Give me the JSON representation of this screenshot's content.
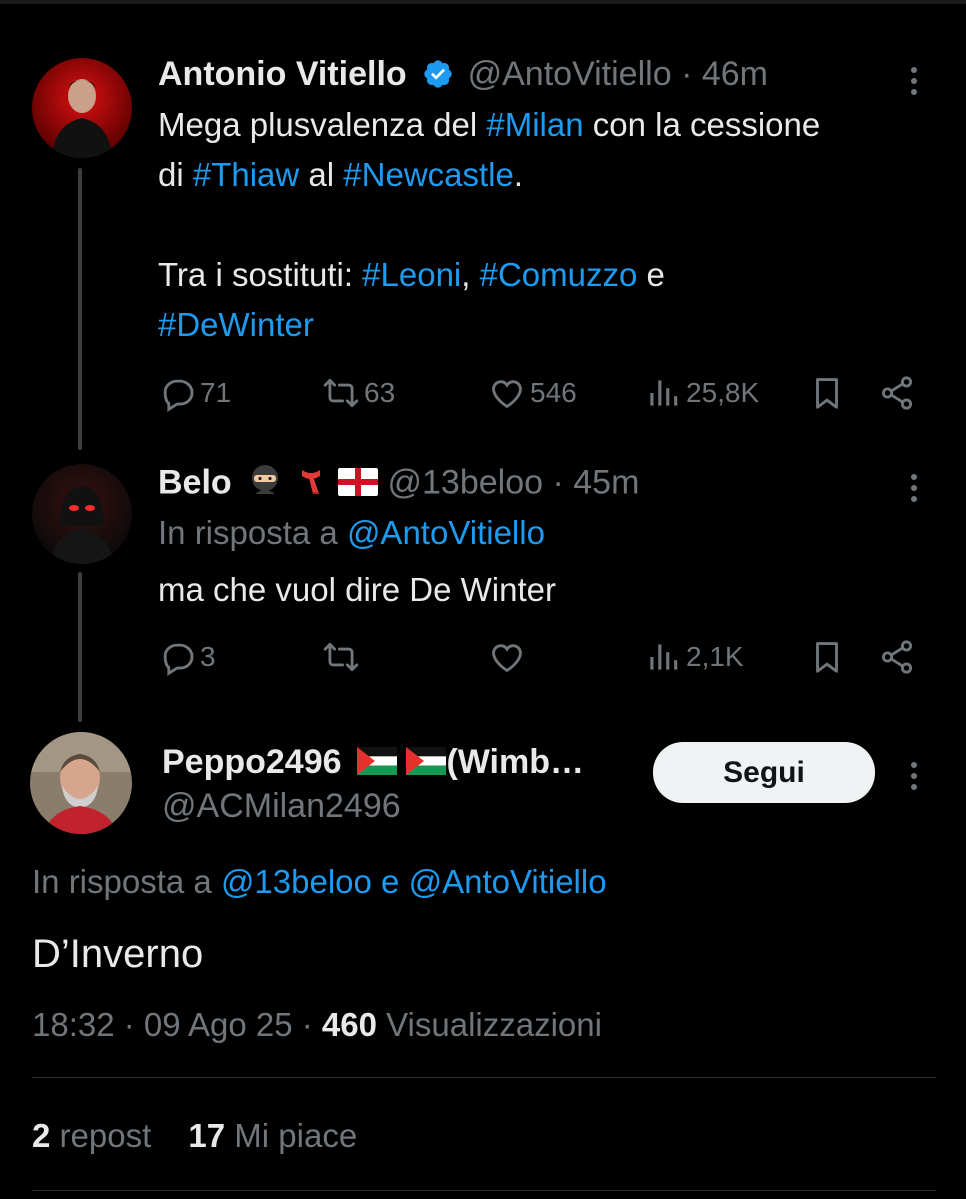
{
  "tweet1": {
    "name": "Antonio Vitiello",
    "handle": "@AntoVitiello",
    "sep": "·",
    "time": "46m",
    "text_a": "Mega plusvalenza del ",
    "tag_milan": "#Milan",
    "text_b": " con la cessione",
    "text_c": "di ",
    "tag_thiaw": "#Thiaw",
    "text_d": " al ",
    "tag_newcastle": "#Newcastle",
    "text_e": ".",
    "text_f": "Tra i sostituti: ",
    "tag_leoni": "#Leoni",
    "text_g": ", ",
    "tag_comuzzo": "#Comuzzo",
    "text_h": " e",
    "tag_dewinter": "#DeWinter",
    "replies": "71",
    "reposts": "63",
    "likes": "546",
    "views": "25,8K"
  },
  "tweet2": {
    "name": "Belo",
    "emojis": [
      "ninja",
      "scarf",
      "england-flag"
    ],
    "handle": "@13beloo",
    "sep": "·",
    "time": "45m",
    "reply_to_label": "In risposta a ",
    "reply_to_handle": "@AntoVitiello",
    "text": "ma che vuol dire De Winter",
    "replies": "3",
    "views": "2,1K"
  },
  "tweet3": {
    "name": "Peppo2496",
    "flags": [
      "palestine-flag",
      "palestine-flag"
    ],
    "name_suffix": "(Wimb…",
    "handle": "@ACMilan2496",
    "follow_label": "Segui",
    "reply_to_label": "In risposta a ",
    "reply_to_handles": "@13beloo e @AntoVitiello",
    "text": "D’Inverno",
    "time": "18:32",
    "sep1": " · ",
    "date": "09 Ago 25",
    "sep2": " · ",
    "views_count": "460",
    "views_label": " Visualizzazioni",
    "reposts_count": "2",
    "reposts_label": " repost",
    "likes_count": "17",
    "likes_label": " Mi piace"
  },
  "colors": {
    "background": "#000000",
    "text": "#e7e9ea",
    "secondary": "#71767b",
    "link": "#1d9bf0",
    "verified": "#1d9bf0"
  }
}
